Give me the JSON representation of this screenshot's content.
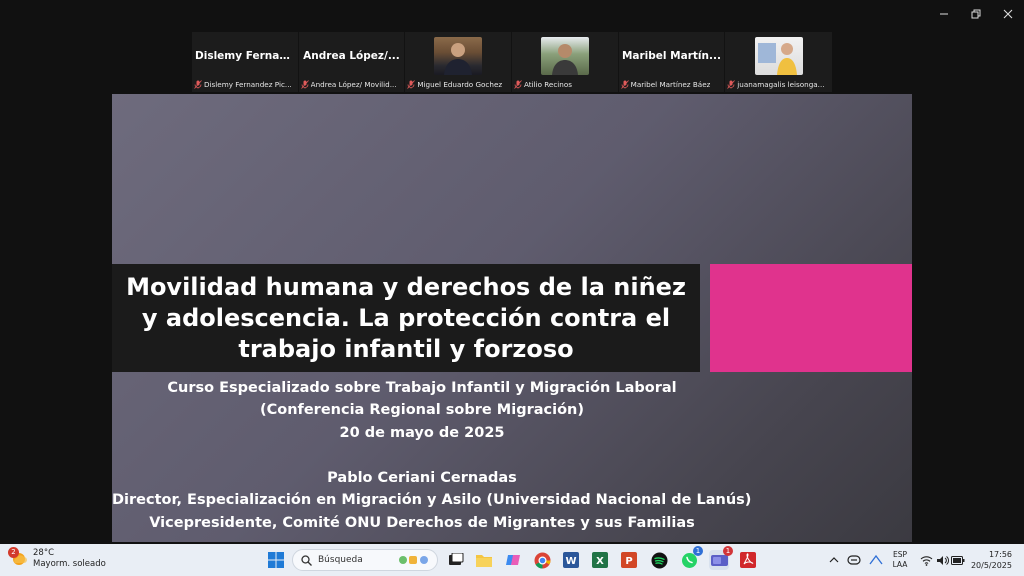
{
  "participants": [
    {
      "kind": "name",
      "display": "Dislemy  Fernan...",
      "label": "Dislemy Fernandez Pic..."
    },
    {
      "kind": "name",
      "display": "Andrea  López/...",
      "label": "Andrea López/ Movilid..."
    },
    {
      "kind": "photo",
      "display": "",
      "label": "Miguel Eduardo Gochez"
    },
    {
      "kind": "photo",
      "display": "",
      "label": "Atilio Recinos"
    },
    {
      "kind": "name",
      "display": "Maribel  Martín...",
      "label": "Maribel Martínez Báez"
    },
    {
      "kind": "photo",
      "display": "",
      "label": "juanamagalis leisonga..."
    }
  ],
  "slide": {
    "title_lines": [
      "Movilidad humana y derechos de la niñez",
      "y adolescencia. La protección contra el",
      "trabajo infantil y forzoso"
    ],
    "course": "Curso Especializado sobre Trabajo Infantil y Migración Laboral",
    "conference": "(Conferencia Regional sobre Migración)",
    "date": "20 de mayo de 2025",
    "speaker": "Pablo Ceriani Cernadas",
    "role1": "Director, Especialización en Migración y Asilo (Universidad Nacional de Lanús)",
    "role2": "Vicepresidente, Comité ONU Derechos de Migrantes y sus Familias",
    "accent_color": "#e0338d"
  },
  "taskbar": {
    "weather_badge": "2",
    "temperature": "28°C",
    "weather_desc": "Mayorm. soleado",
    "search_placeholder": "Búsqueda",
    "whatsapp_badge": "1",
    "teams_badge": "1",
    "lang_top": "ESP",
    "lang_bottom": "LAA",
    "time": "17:56",
    "date": "20/5/2025"
  }
}
